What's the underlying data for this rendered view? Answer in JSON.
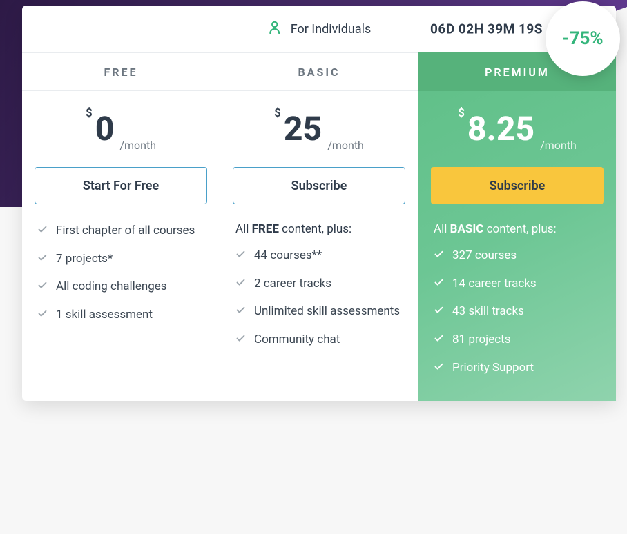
{
  "header": {
    "individuals_label": "For Individuals",
    "countdown": "06D 02H 39M 19S",
    "discount": "-75%"
  },
  "plans": {
    "free": {
      "name": "FREE",
      "currency": "$",
      "amount": "0",
      "period": "/month",
      "cta": "Start For Free",
      "features": [
        "First chapter of all courses",
        "7 projects*",
        "All coding challenges",
        "1 skill assessment"
      ]
    },
    "basic": {
      "name": "BASIC",
      "currency": "$",
      "amount": "25",
      "period": "/month",
      "cta": "Subscribe",
      "lead_pre": "All ",
      "lead_bold": "FREE",
      "lead_post": " content, plus:",
      "features": [
        "44 courses**",
        "2 career tracks",
        "Unlimited skill assessments",
        "Community chat"
      ]
    },
    "premium": {
      "name": "PREMIUM",
      "currency": "$",
      "amount": "8.25",
      "period": "/month",
      "cta": "Subscribe",
      "lead_pre": "All ",
      "lead_bold": "BASIC",
      "lead_post": " content, plus:",
      "features": [
        "327 courses",
        "14 career tracks",
        "43 skill tracks",
        "81 projects",
        "Priority Support"
      ]
    }
  },
  "colors": {
    "accent_green": "#34b57b",
    "cta_yellow": "#f9c63d",
    "outline_blue": "#4aa0c9"
  }
}
